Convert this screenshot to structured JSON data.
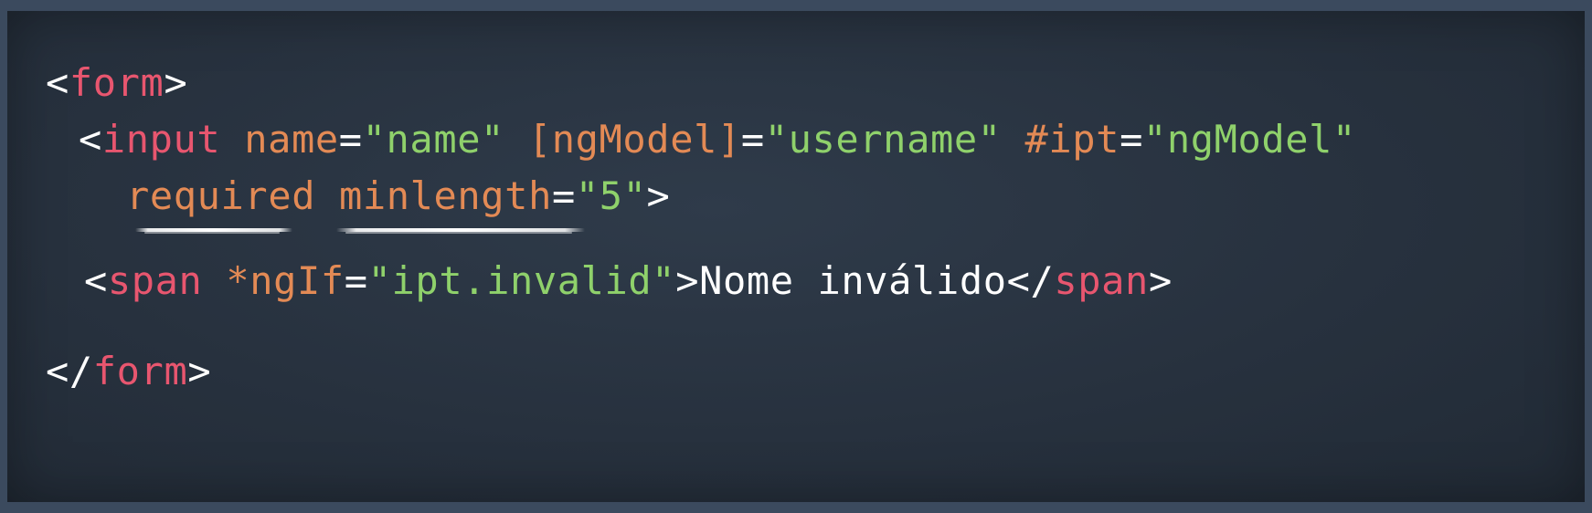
{
  "code": {
    "line1": {
      "open": "<",
      "tag": "form",
      "close": ">"
    },
    "line2": {
      "open": "<",
      "tag": "input",
      "attr1": "name",
      "eq1": "=",
      "val1": "\"name\"",
      "attr2": "[ngModel]",
      "eq2": "=",
      "val2": "\"username\"",
      "attr3": "#ipt",
      "eq3": "=",
      "val3": "\"ngModel\""
    },
    "line3": {
      "attr1": "required",
      "attr2": "minlength",
      "eq": "=",
      "val": "\"5\"",
      "close": ">"
    },
    "line4": {
      "open": "<",
      "tag": "span",
      "attr": "*ngIf",
      "eq": "=",
      "val": "\"ipt.invalid\"",
      "gt": ">",
      "text": "Nome inválido",
      "closeOpen": "</",
      "closeTag": "span",
      "closeGt": ">"
    },
    "line5": {
      "open": "</",
      "tag": "form",
      "close": ">"
    }
  },
  "colors": {
    "tag": "#e8566f",
    "attribute": "#e38a55",
    "string": "#8fd16b",
    "punctuation": "#ffffff",
    "background": "#27313e"
  }
}
